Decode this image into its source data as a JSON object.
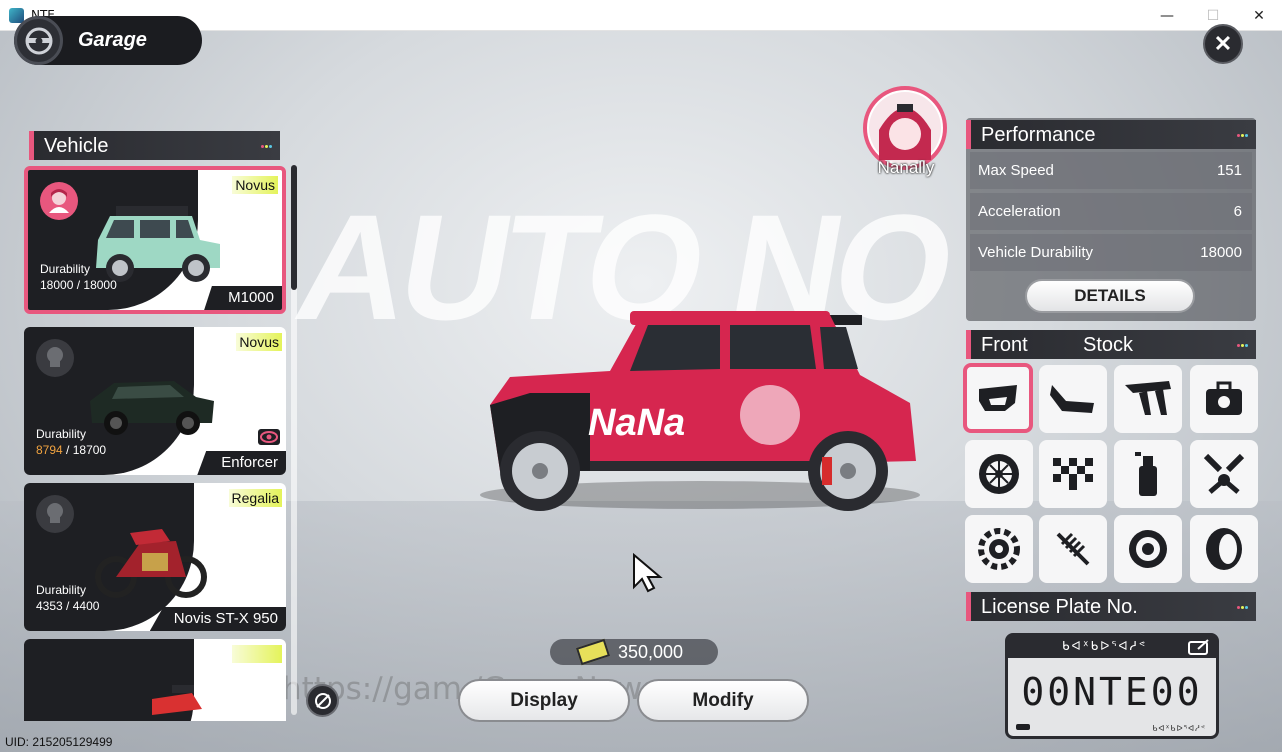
{
  "window": {
    "title": "NTE",
    "minimize": "—",
    "maximize": "☐",
    "close": "✕"
  },
  "header": {
    "title": "Garage",
    "close_label": "✕"
  },
  "background": {
    "text": "AUTO NO",
    "watermark": "https://gam              /GameNews"
  },
  "vehicle_panel": {
    "title": "Vehicle",
    "cards": [
      {
        "brand": "Novus",
        "durability_label": "Durability",
        "durability_current": "18000",
        "durability_max": "18000",
        "model": "M1000",
        "selected": true
      },
      {
        "brand": "Novus",
        "durability_label": "Durability",
        "durability_current": "8794",
        "durability_max": "18700",
        "model": "Enforcer",
        "selected": false
      },
      {
        "brand": "Regalia",
        "durability_label": "Durability",
        "durability_current": "4353",
        "durability_max": "4400",
        "model": "Novis ST-X 950",
        "selected": false
      }
    ],
    "durability_separator": " / "
  },
  "pilot": {
    "name": "Nanally"
  },
  "performance": {
    "title": "Performance",
    "rows": [
      {
        "label": "Max Speed",
        "value": "151"
      },
      {
        "label": "Acceleration",
        "value": "6"
      },
      {
        "label": "Vehicle Durability",
        "value": "18000"
      }
    ],
    "details_label": "DETAILS"
  },
  "parts": {
    "category": "Front",
    "variant": "Stock",
    "icons": [
      "front-bumper-icon",
      "rear-bumper-icon",
      "spoiler-icon",
      "toolkit-icon",
      "wheel-rim-icon",
      "checkered-flag-icon",
      "spray-paint-icon",
      "engine-piston-icon",
      "gear-brake-icon",
      "suspension-spring-icon",
      "brake-disc-icon",
      "tire-icon"
    ],
    "selected_index": 0
  },
  "license_plate": {
    "title": "License Plate No.",
    "top_code": "ᑲᐊᕁᑲᐅᕐᐊᓱᕝ",
    "number": "00NTE00",
    "bottom_code": "ᑲᐊᕁᑲᐅᕐᐊᓱᕝ"
  },
  "currency": {
    "amount": "350,000"
  },
  "actions": {
    "display": "Display",
    "modify": "Modify"
  },
  "footer": {
    "uid": "UID: 215205129499"
  },
  "colors": {
    "accent": "#e8577e",
    "dark": "#1e1f23",
    "brand_highlight": "#e4f35a",
    "low_durability": "#f1a340"
  }
}
